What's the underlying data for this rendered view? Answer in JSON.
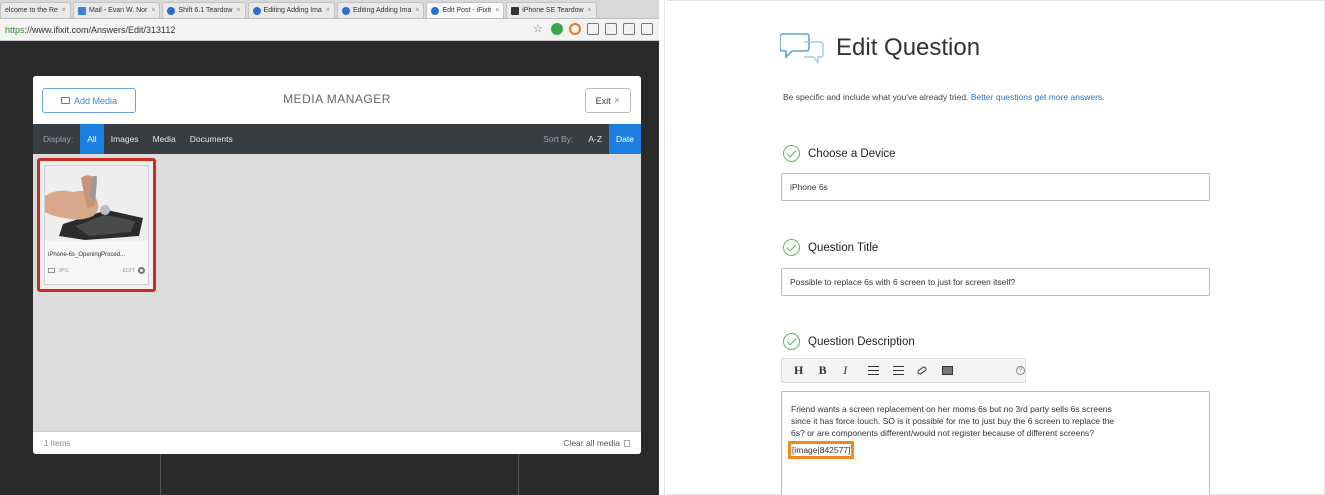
{
  "browser": {
    "tabs": [
      {
        "label": "elcome to the Re",
        "icon": "none"
      },
      {
        "label": "Mail - Evan W. Nor",
        "icon": "mail"
      },
      {
        "label": "Shift 6.1 Teardow",
        "icon": "ifixit"
      },
      {
        "label": "Editing Adding Ima",
        "icon": "ifixit"
      },
      {
        "label": "Editing Adding Ima",
        "icon": "ifixit"
      },
      {
        "label": "Edit Post - iFixit",
        "icon": "ifixit"
      },
      {
        "label": "iPhone SE Teardow",
        "icon": "dark"
      }
    ],
    "url_proto": "https",
    "url_rest": "://www.ifixit.com/Answers/Edit/313112"
  },
  "media_manager": {
    "add_media_label": "Add Media",
    "title": "MEDIA MANAGER",
    "exit_label": "Exit",
    "display_label": "Display:",
    "filters": [
      "All",
      "Images",
      "Media",
      "Documents"
    ],
    "active_filter": "All",
    "sort_label": "Sort By:",
    "sort_options": [
      "A-Z",
      "Date"
    ],
    "active_sort": "Date",
    "item": {
      "name": "iPhone-6s_OpeningProced...",
      "type": "JPG",
      "edit_label": "EDIT"
    },
    "items_count": "1 Items",
    "clear_all_label": "Clear all media"
  },
  "edit_question": {
    "title": "Edit Question",
    "hint_text": "Be specific and include what you've already tried.",
    "hint_link": "Better questions get more answers.",
    "device_label": "Choose a Device",
    "device_value": "iPhone 6s",
    "question_title_label": "Question Title",
    "question_title_value": "Possible to replace 6s with 6 screen to just for screen itself?",
    "description_label": "Question Description",
    "toolbar": [
      "H",
      "B",
      "I"
    ],
    "description_lines": [
      "Friend wants a screen replacement on her moms 6s but no 3rd party sells 6s screens",
      "since it has force touch. SO is it possible for me to just buy the 6 screen to replace the",
      "6s? or are components different/would not register because of different screens?"
    ],
    "image_tag": "[image|842577]"
  },
  "colors": {
    "highlight_red": "#cc2a1e",
    "highlight_orange": "#ef8a1e",
    "accent_blue": "#1b7ee0",
    "check_green": "#5cb85c"
  }
}
